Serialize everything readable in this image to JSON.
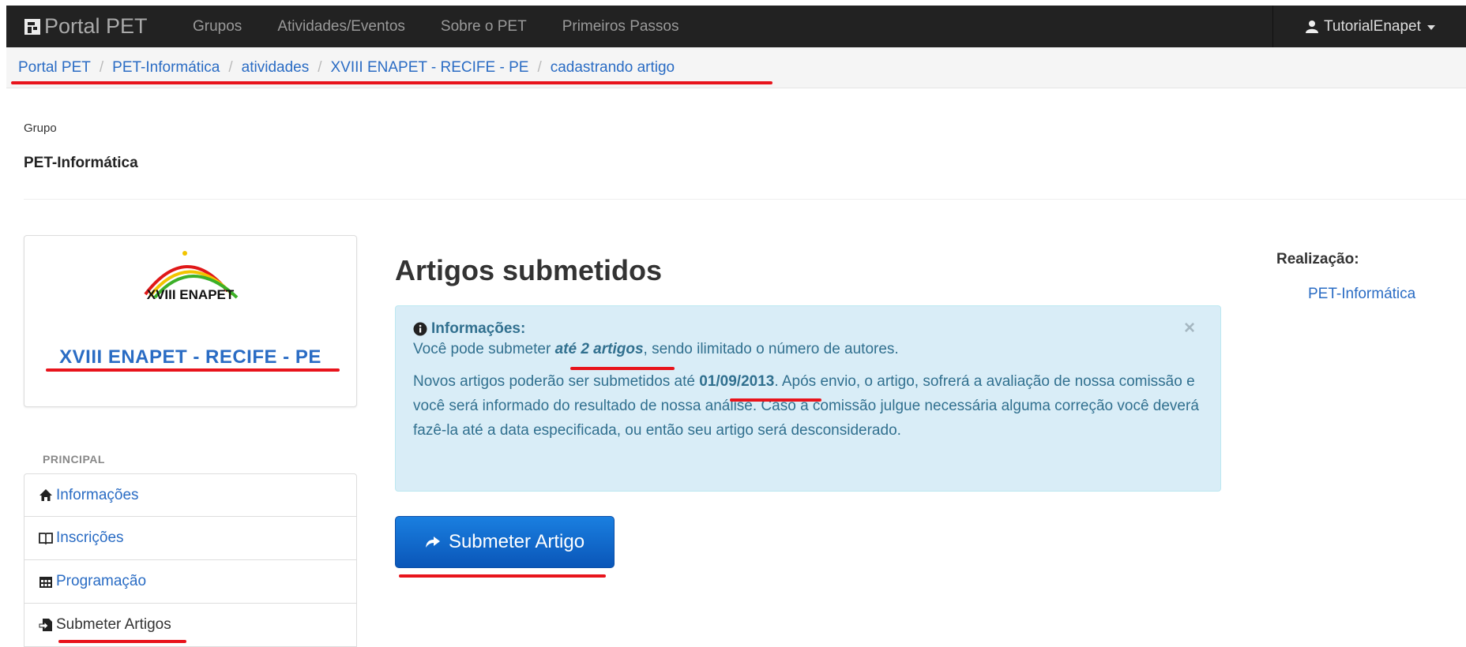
{
  "navbar": {
    "brand": "Portal PET",
    "items": [
      "Grupos",
      "Atividades/Eventos",
      "Sobre o PET",
      "Primeiros Passos"
    ],
    "user": "TutorialEnapet"
  },
  "breadcrumb": [
    "Portal PET",
    "PET-Informática",
    "atividades",
    "XVIII ENAPET - RECIFE - PE",
    "cadastrando artigo"
  ],
  "group": {
    "label": "Grupo",
    "name": "PET-Informática"
  },
  "event": {
    "logo_text": "XVIII ENAPET",
    "title": "XVIII ENAPET - RECIFE - PE"
  },
  "sidebar": {
    "section": "PRINCIPAL",
    "items": [
      {
        "label": "Informações",
        "icon": "home-icon"
      },
      {
        "label": "Inscrições",
        "icon": "book-icon"
      },
      {
        "label": "Programação",
        "icon": "calendar-icon"
      },
      {
        "label": "Submeter Artigos",
        "icon": "file-submit-icon"
      }
    ]
  },
  "main": {
    "title": "Artigos submetidos",
    "alert": {
      "heading": "Informações:",
      "line1_pre": "Você pode submeter ",
      "line1_em": "até 2 artigos",
      "line1_post": ", sendo ilimitado o número de autores.",
      "p2_pre": "Novos artigos poderão ser submetidos até ",
      "p2_date": "01/09/2013",
      "p2_post": ". Após envio, o artigo, sofrerá a avaliação de nossa comissão e você será informado do resultado de nossa análise. Caso a comissão julgue necessária alguma correção você deverá fazê-la até a data especificada, ou então seu artigo será desconsiderado.",
      "close": "×"
    },
    "submit_button": "Submeter Artigo"
  },
  "aside": {
    "label": "Realização:",
    "link": "PET-Informática"
  },
  "colors": {
    "navbar": "#222222",
    "link": "#2a6cc4",
    "alert_bg": "#d9edf7",
    "alert_text": "#31708f",
    "button": "#0a63c9",
    "annotation": "#e8141c"
  }
}
